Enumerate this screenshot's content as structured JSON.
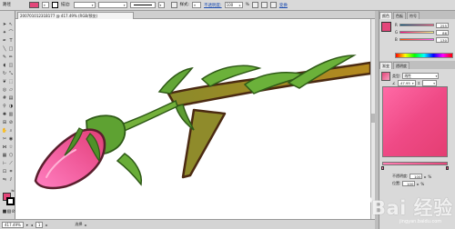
{
  "control_bar": {
    "mode_label": "路径",
    "fill_color": "#e4467a",
    "stroke_label": "描边:",
    "point_value": "",
    "opacity_label": "不透明度:",
    "opacity_value": "100",
    "opacity_unit": "%",
    "style_label": "样式:",
    "transform_link": "变换"
  },
  "document_tab": {
    "title": "20070101231B177 @ 417.49% (RGB/预览)"
  },
  "status_bar": {
    "zoom": "417.49%",
    "page": "1",
    "selection_info": "选择"
  },
  "panel_tabs": [
    "颜色",
    "色板",
    "符号"
  ],
  "color": {
    "swatch": "#e4467a",
    "rows": [
      {
        "channel": "R",
        "value": "255"
      },
      {
        "channel": "G",
        "value": "86"
      },
      {
        "channel": "B",
        "value": "130"
      }
    ]
  },
  "gradient": {
    "tabs": [
      "渐变",
      "透明度"
    ],
    "type_label": "类型:",
    "type_value": "线性",
    "angle_value": "-47.95",
    "location_label": "位置:",
    "location_value": "",
    "opacity_label": "不透明度:",
    "opacity_value": "100",
    "position_label": "位置:",
    "position_value": "100",
    "preview_start": "#ff6aa6",
    "preview_end": "#e43e72"
  },
  "watermark": {
    "text": "Bai 经验",
    "url": "jingyan.baidu.com"
  },
  "icons": [
    "selection-tool",
    "direct-select-tool",
    "magic-wand-tool",
    "lasso-tool",
    "pen-tool",
    "type-tool",
    "line-tool",
    "rectangle-tool",
    "brush-tool",
    "pencil-tool",
    "rotate-tool",
    "scale-tool",
    "warp-tool",
    "free-transform-tool",
    "symbol-sprayer-tool",
    "graph-tool",
    "mesh-tool",
    "gradient-tool",
    "eyedropper-tool",
    "blend-tool",
    "live-paint-tool",
    "slice-tool",
    "eraser-tool",
    "scissors-tool",
    "hand-tool",
    "zoom-tool"
  ]
}
